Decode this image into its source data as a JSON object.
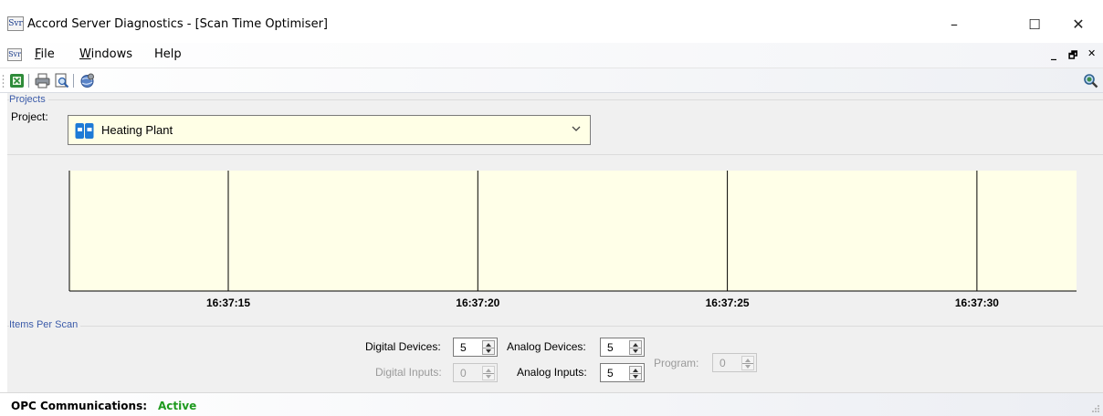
{
  "window": {
    "app_icon": "Svr",
    "title": "Accord Server Diagnostics - [Scan Time Optimiser]",
    "minimize_glyph": "–",
    "maximize_glyph": "☐",
    "close_glyph": "✕"
  },
  "menu": {
    "items": [
      {
        "label": "File",
        "mnemonic": "F"
      },
      {
        "label": "Windows",
        "mnemonic": "W"
      },
      {
        "label": "Help",
        "mnemonic": ""
      }
    ],
    "mdi_min": "_",
    "mdi_restore": "🗗",
    "mdi_close": "✕"
  },
  "toolbar": {
    "icons": [
      "excel-export-icon",
      "print-icon",
      "print-preview-icon",
      "help-globe-icon",
      "search-icon"
    ]
  },
  "projects": {
    "group_label": "Projects",
    "project_label": "Project:",
    "selected_project": "Heating Plant"
  },
  "chart_data": {
    "type": "line",
    "x_ticks": [
      "16:37:15",
      "16:37:20",
      "16:37:25",
      "16:37:30"
    ],
    "series": [],
    "background": "#ffffe8",
    "grid": "vertical"
  },
  "items_per_scan": {
    "group_label": "Items Per Scan",
    "digital_devices": {
      "label": "Digital Devices:",
      "value": "5",
      "enabled": true
    },
    "analog_devices": {
      "label": "Analog Devices:",
      "value": "5",
      "enabled": true
    },
    "digital_inputs": {
      "label": "Digital Inputs:",
      "value": "0",
      "enabled": false
    },
    "analog_inputs": {
      "label": "Analog Inputs:",
      "value": "5",
      "enabled": true
    },
    "program": {
      "label": "Program:",
      "value": "0",
      "enabled": false
    }
  },
  "status": {
    "label": "OPC Communications:",
    "value": "Active",
    "value_color": "#1e9a1e"
  }
}
